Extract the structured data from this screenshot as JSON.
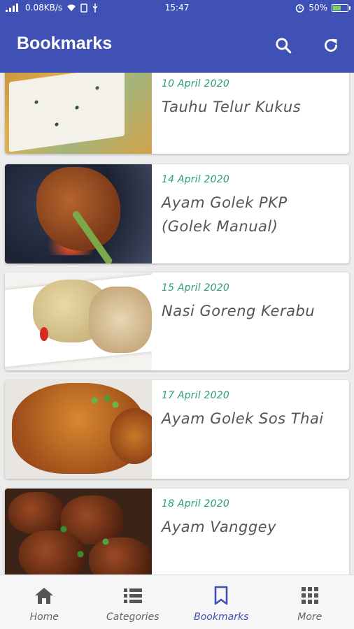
{
  "status_bar": {
    "net_speed": "0.08KB/s",
    "time": "15:47",
    "battery": "50%",
    "battery_level": 0.5
  },
  "app_bar": {
    "title": "Bookmarks",
    "actions": [
      {
        "icon": "search-icon"
      },
      {
        "icon": "refresh-icon"
      }
    ]
  },
  "bookmarks": [
    {
      "date": "10 April 2020",
      "title": "Tauhu Telur Kukus"
    },
    {
      "date": "14 April 2020",
      "title": "Ayam Golek PKP (Golek Manual)"
    },
    {
      "date": "15 April 2020",
      "title": "Nasi Goreng Kerabu"
    },
    {
      "date": "17 April 2020",
      "title": "Ayam Golek Sos Thai"
    },
    {
      "date": "18 April 2020",
      "title": "Ayam Vanggey"
    }
  ],
  "bottom_nav": [
    {
      "label": "Home",
      "icon": "home-icon"
    },
    {
      "label": "Categories",
      "icon": "list-icon"
    },
    {
      "label": "Bookmarks",
      "icon": "bookmark-icon",
      "active": true
    },
    {
      "label": "More",
      "icon": "grid-icon"
    }
  ],
  "colors": {
    "primary": "#3f51b5",
    "date_accent": "#2a9d7a",
    "title_text": "#555555"
  }
}
